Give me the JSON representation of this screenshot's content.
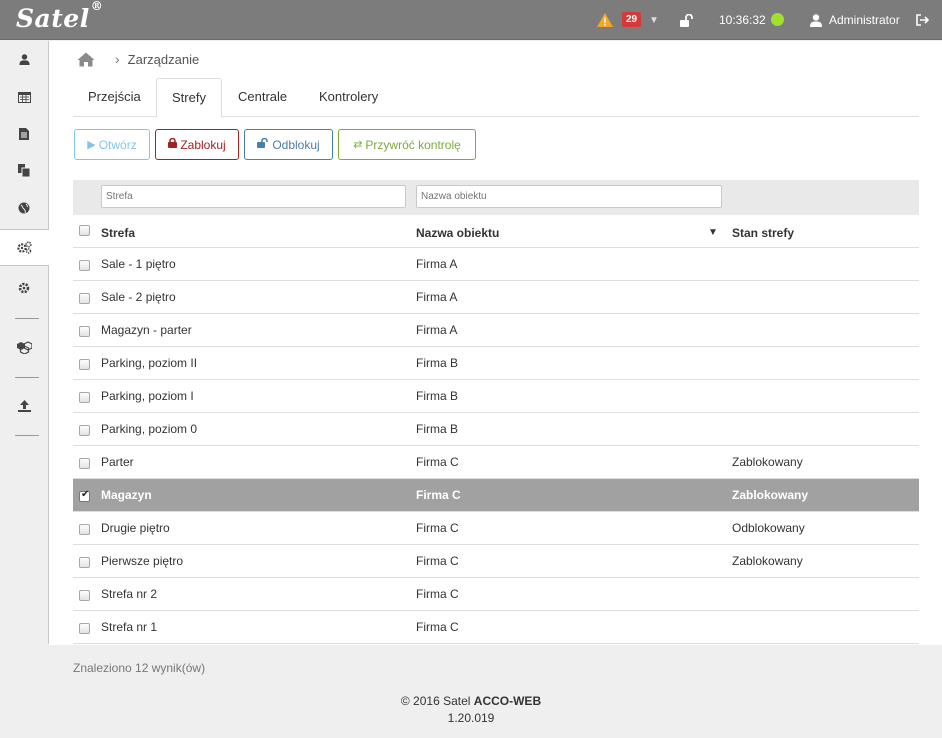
{
  "app": {
    "logo": "Satel",
    "logo_mark": "®"
  },
  "topbar": {
    "alarm_count": "29",
    "time": "10:36:32",
    "user_name": "Administrator",
    "status_color": "#9fe12e"
  },
  "sidebar": {
    "items": [
      {
        "icon": "user-icon"
      },
      {
        "icon": "calendar-icon"
      },
      {
        "icon": "document-icon"
      },
      {
        "icon": "copy-icon"
      },
      {
        "icon": "globe-icon"
      },
      {
        "icon": "cogs-icon",
        "active": true
      },
      {
        "icon": "gear-icon"
      },
      {
        "icon": "cubes-icon"
      },
      {
        "icon": "upload-icon"
      }
    ]
  },
  "breadcrumb": {
    "current": "Zarządzanie"
  },
  "tabs": [
    {
      "label": "Przejścia"
    },
    {
      "label": "Strefy",
      "active": true
    },
    {
      "label": "Centrale"
    },
    {
      "label": "Kontrolery"
    }
  ],
  "actions": {
    "open": "Otwórz",
    "lock": "Zablokuj",
    "unlock": "Odblokuj",
    "restore": "Przywróć kontrolę"
  },
  "filters": {
    "zone_placeholder": "Strefa",
    "object_placeholder": "Nazwa obiektu"
  },
  "table": {
    "columns": [
      "Strefa",
      "Nazwa obiektu",
      "Stan strefy"
    ],
    "rows": [
      {
        "zone": "Sale - 1 piętro",
        "object": "Firma A",
        "state": ""
      },
      {
        "zone": "Sale - 2 piętro",
        "object": "Firma A",
        "state": ""
      },
      {
        "zone": "Magazyn - parter",
        "object": "Firma A",
        "state": ""
      },
      {
        "zone": "Parking, poziom II",
        "object": "Firma B",
        "state": ""
      },
      {
        "zone": "Parking, poziom I",
        "object": "Firma B",
        "state": ""
      },
      {
        "zone": "Parking, poziom 0",
        "object": "Firma B",
        "state": ""
      },
      {
        "zone": "Parter",
        "object": "Firma C",
        "state": "Zablokowany"
      },
      {
        "zone": "Magazyn",
        "object": "Firma C",
        "state": "Zablokowany",
        "selected": true
      },
      {
        "zone": "Drugie piętro",
        "object": "Firma C",
        "state": "Odblokowany"
      },
      {
        "zone": "Pierwsze piętro",
        "object": "Firma C",
        "state": "Zablokowany"
      },
      {
        "zone": "Strefa nr 2",
        "object": "Firma C",
        "state": ""
      },
      {
        "zone": "Strefa nr 1",
        "object": "Firma C",
        "state": ""
      }
    ]
  },
  "results_text": "Znaleziono 12 wynik(ów)",
  "footer": {
    "copyright": "© 2016 Satel",
    "product": "ACCO-WEB",
    "version": "1.20.019"
  }
}
